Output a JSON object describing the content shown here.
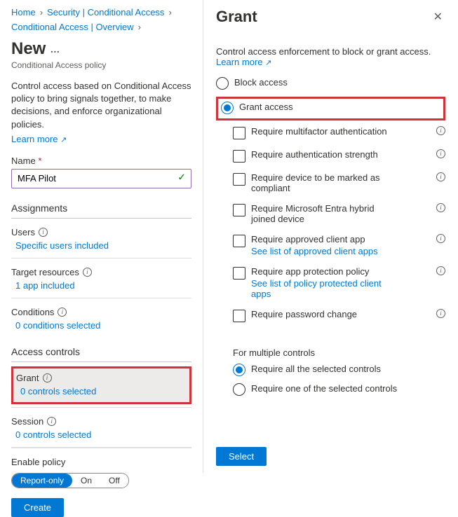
{
  "breadcrumb": {
    "home": "Home",
    "security": "Security | Conditional Access",
    "overview": "Conditional Access | Overview"
  },
  "page": {
    "title": "New",
    "subtitle": "Conditional Access policy",
    "description": "Control access based on Conditional Access policy to bring signals together, to make decisions, and enforce organizational policies.",
    "learn_more": "Learn more"
  },
  "name_field": {
    "label": "Name",
    "value": "MFA Pilot"
  },
  "assignments": {
    "header": "Assignments",
    "users_label": "Users",
    "users_value": "Specific users included",
    "targets_label": "Target resources",
    "targets_value": "1 app included",
    "conditions_label": "Conditions",
    "conditions_value": "0 conditions selected"
  },
  "access_controls": {
    "header": "Access controls",
    "grant_label": "Grant",
    "grant_value": "0 controls selected",
    "session_label": "Session",
    "session_value": "0 controls selected"
  },
  "footer_left": {
    "enable_label": "Enable policy",
    "opt_report": "Report-only",
    "opt_on": "On",
    "opt_off": "Off",
    "create": "Create"
  },
  "panel": {
    "title": "Grant",
    "desc": "Control access enforcement to block or grant access.",
    "learn_more": "Learn more",
    "block": "Block access",
    "grant": "Grant access",
    "checks": {
      "mfa": "Require multifactor authentication",
      "strength": "Require authentication strength",
      "compliant": "Require device to be marked as compliant",
      "hybrid": "Require Microsoft Entra hybrid joined device",
      "approved": "Require approved client app",
      "approved_link": "See list of approved client apps",
      "protection": "Require app protection policy",
      "protection_link": "See list of policy protected client apps",
      "password": "Require password change"
    },
    "multi_label": "For multiple controls",
    "multi_all": "Require all the selected controls",
    "multi_one": "Require one of the selected controls",
    "select": "Select"
  }
}
